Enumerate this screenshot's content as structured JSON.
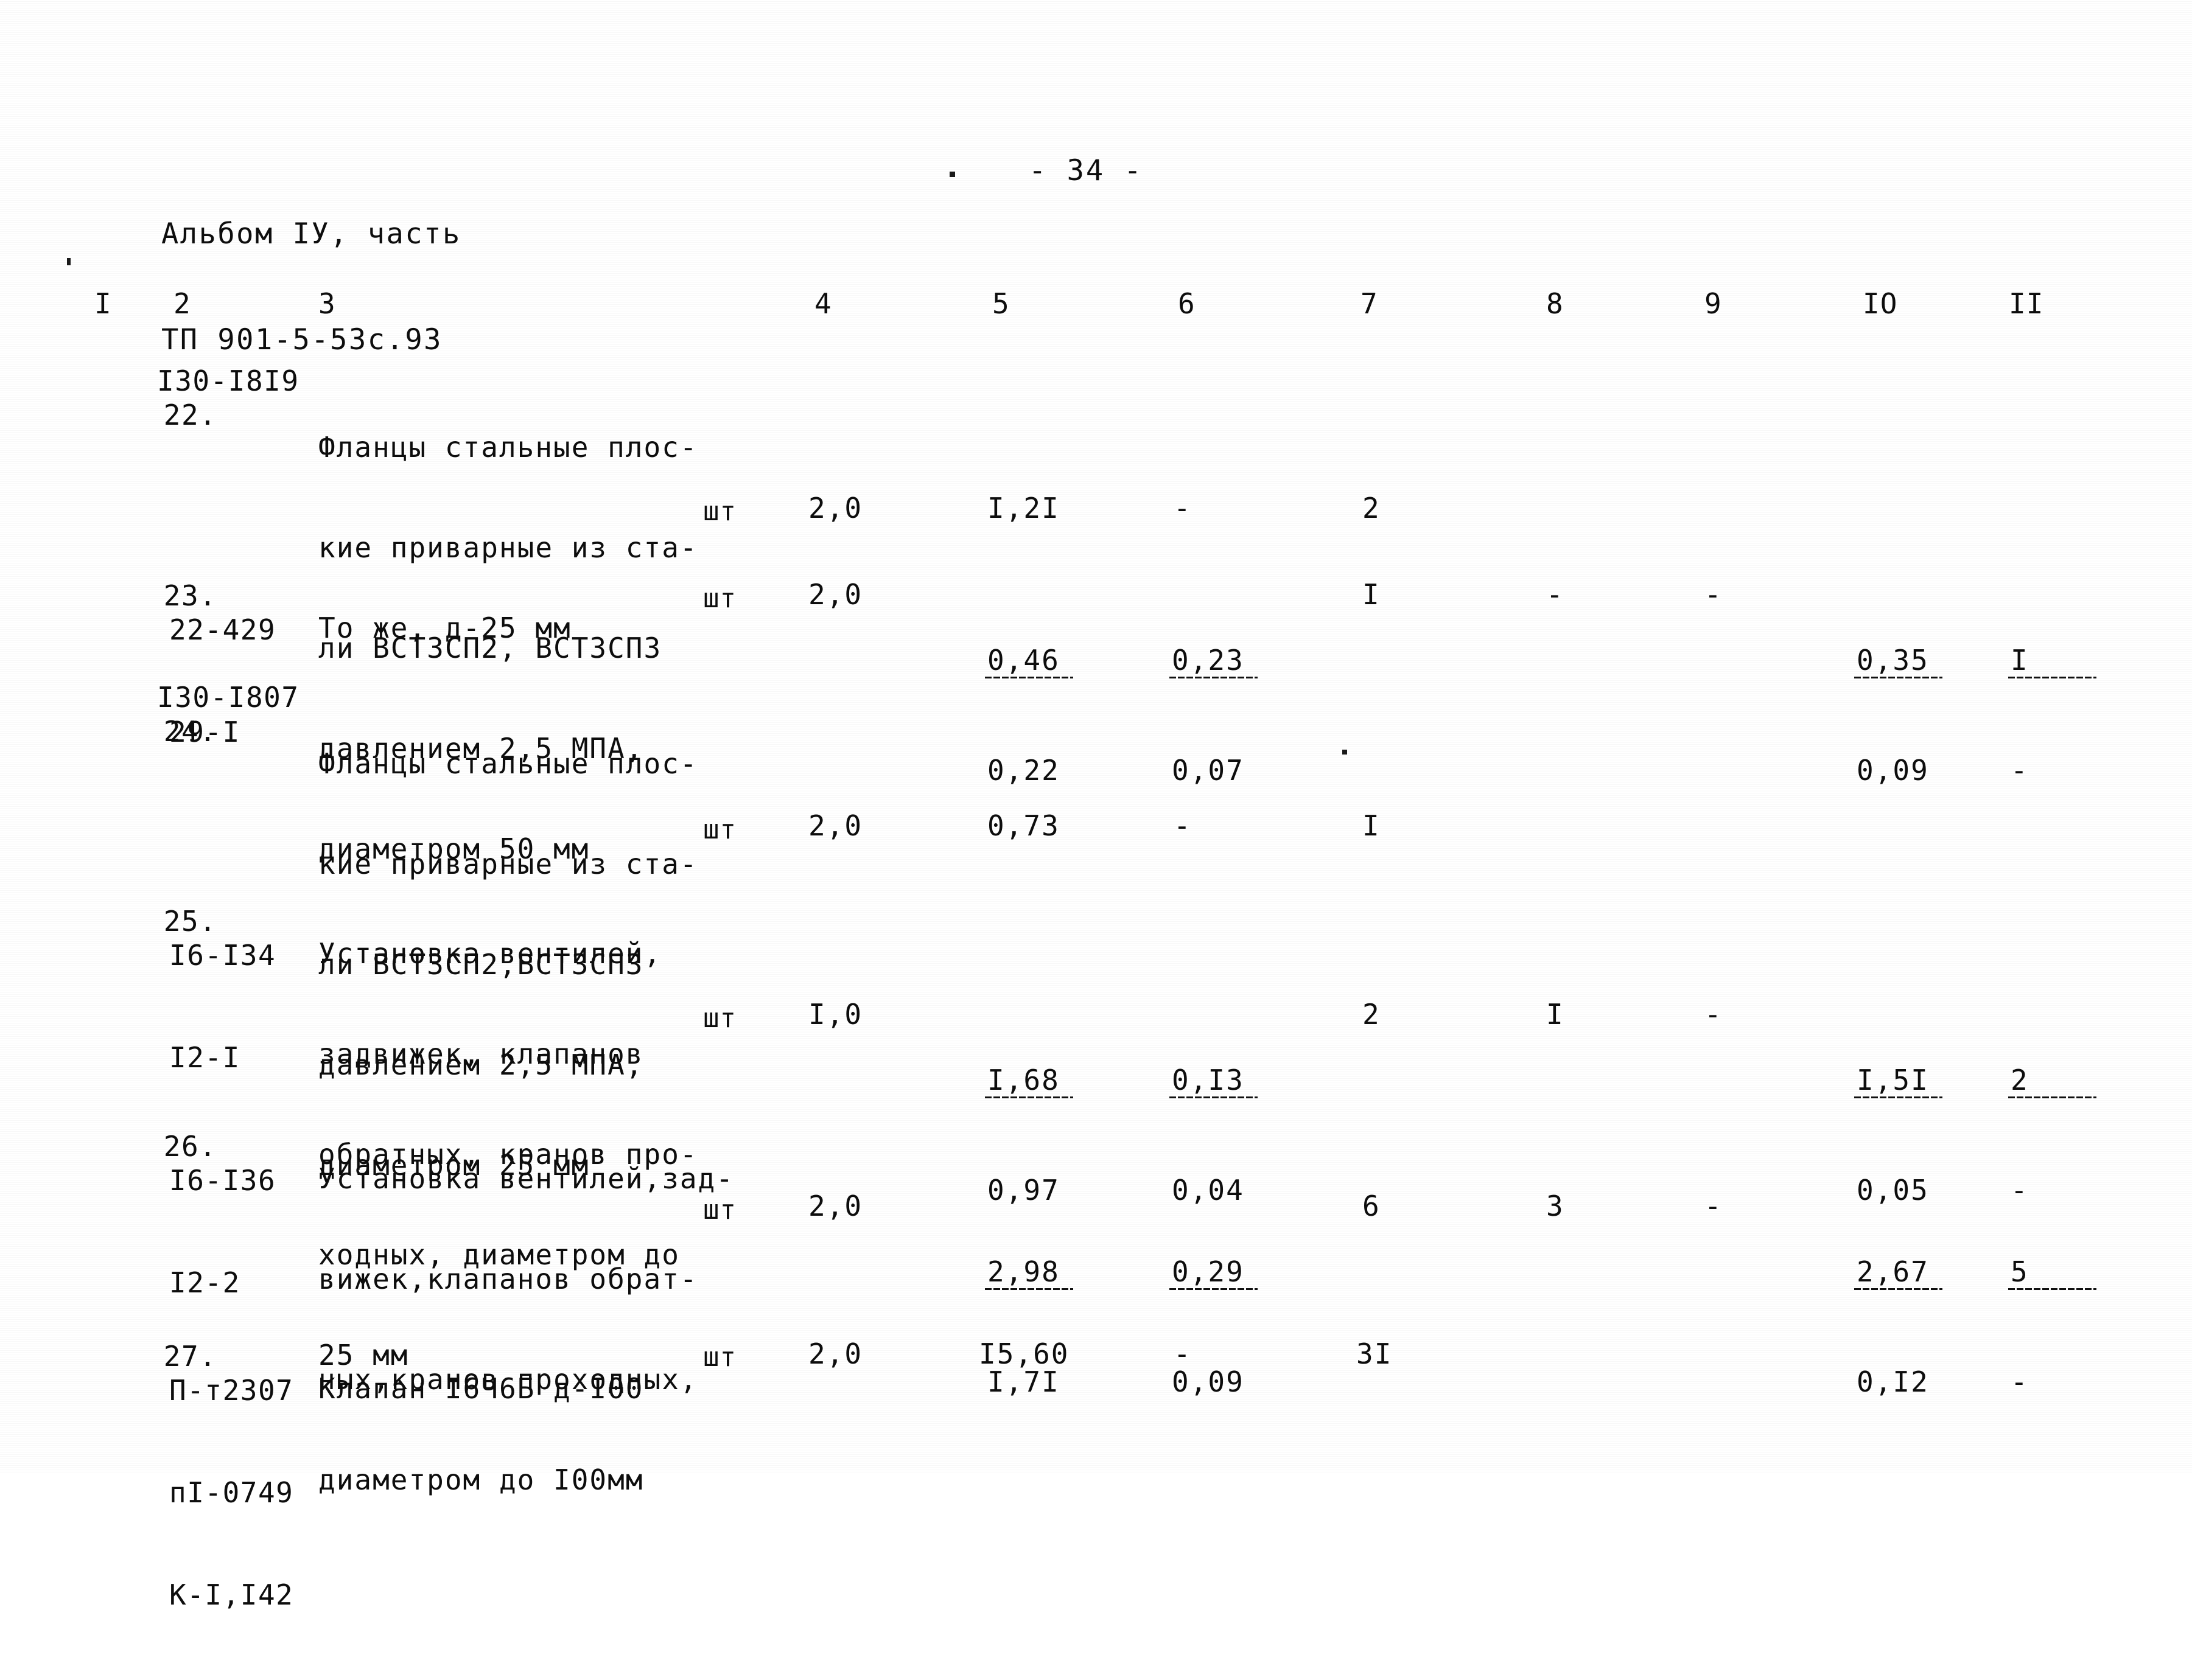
{
  "header": {
    "album_line1": "Альбом IУ, часть",
    "album_line2": "ТП 901-5-53с.93",
    "page_marker": "- 34 -"
  },
  "table": {
    "column_headers": [
      "I",
      "2",
      "3",
      "4",
      "5",
      "6",
      "7",
      "8",
      "9",
      "IO",
      "II"
    ],
    "rows": [
      {
        "num": "22.",
        "code": "I30-I8I9",
        "desc": [
          "Фланцы стальные плос-",
          "кие приварные из ста-",
          "ли ВСТ3СП2, ВСТ3СП3",
          "давлением 2,5 МПА,",
          "диаметром 50 мм"
        ],
        "unit": "шт",
        "c4": "2,0",
        "c5": "I,2I",
        "c5b": "",
        "c6": "-",
        "c6b": "",
        "c7": "2",
        "c8": "",
        "c9": "",
        "c10": "",
        "c10b": "",
        "c11": "",
        "c11b": ""
      },
      {
        "num": "23.",
        "code": "22-429",
        "code2": "29-I",
        "desc": [
          "То же, д-25 мм"
        ],
        "unit": "шт",
        "c4": "2,0",
        "c5": "0,46",
        "c5b": "0,22",
        "c6": "0,23",
        "c6b": "0,07",
        "c7": "I",
        "c8": "-",
        "c9": "-",
        "c10": "0,35",
        "c10b": "0,09",
        "c11": "I",
        "c11b": "-"
      },
      {
        "num": "24.",
        "code": "I30-I807",
        "desc": [
          "Фланцы стальные плос-",
          "кие приварные из ста-",
          "ли ВСТ3СП2,ВСТ3СП3",
          "давлением 2,5 МПА,",
          "диаметром 25 мм"
        ],
        "unit": "шт",
        "c4": "2,0",
        "c5": "0,73",
        "c5b": "",
        "c6": "-",
        "c6b": "",
        "c7": "I",
        "c8": "",
        "c9": "",
        "c10": "",
        "c10b": "",
        "c11": "",
        "c11b": ""
      },
      {
        "num": "25.",
        "code": "I6-I34",
        "code2": "I2-I",
        "desc": [
          "Установка вентилей,",
          "задвижек, клапанов",
          "обратных, кранов про-",
          "ходных, диаметром до",
          "25 мм"
        ],
        "unit": "шт",
        "c4": "I,0",
        "c5": "I,68",
        "c5b": "0,97",
        "c6": "0,I3",
        "c6b": "0,04",
        "c7": "2",
        "c8": "I",
        "c9": "-",
        "c10": "I,5I",
        "c10b": "0,05",
        "c11": "2",
        "c11b": "-"
      },
      {
        "num": "26.",
        "code": "I6-I36",
        "code2": "I2-2",
        "desc": [
          "Установка вентилей,зад-",
          "вижек,клапанов обрат-",
          "ных,кранов проходных,",
          "диаметром до I00мм"
        ],
        "unit": "шт",
        "c4": "2,0",
        "c5": "2,98",
        "c5b": "I,7I",
        "c6": "0,29",
        "c6b": "0,09",
        "c7": "6",
        "c8": "3",
        "c9": "-",
        "c10": "2,67",
        "c10b": "0,I2",
        "c11": "5",
        "c11b": "-"
      },
      {
        "num": "27.",
        "code": "П-т2307",
        "code2": "пI-0749",
        "code3": "К-I,I42",
        "desc": [
          "Клапан I6Ч6Б д-I00"
        ],
        "unit": "шт",
        "c4": "2,0",
        "c5": "I5,60",
        "c5b": "",
        "c6": "-",
        "c6b": "",
        "c7": "3I",
        "c8": "",
        "c9": "",
        "c10": "",
        "c10b": "",
        "c11": "",
        "c11b": ""
      }
    ]
  }
}
